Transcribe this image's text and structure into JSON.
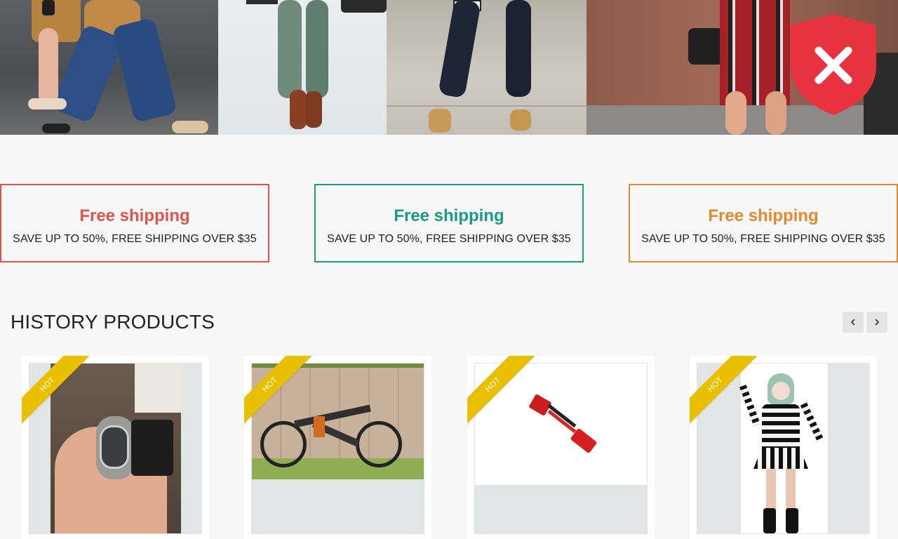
{
  "hero": {
    "panels": [
      "street-style-jeans-photo",
      "street-style-boots-photo",
      "street-style-leopard-flats-photo",
      "street-style-plaid-skirt-photo"
    ],
    "badge_icon": "shield-close-icon"
  },
  "shipping": [
    {
      "title": "Free shipping",
      "subtitle": "SAVE UP TO 50%, FREE SHIPPING OVER $35",
      "color": "#e0534a"
    },
    {
      "title": "Free shipping",
      "subtitle": "SAVE UP TO 50%, FREE SHIPPING OVER $35",
      "color": "#1a9b86"
    },
    {
      "title": "Free shipping",
      "subtitle": "SAVE UP TO 50%, FREE SHIPPING OVER $35",
      "color": "#e38a2c"
    }
  ],
  "section": {
    "title": "HISTORY PRODUCTS",
    "prev_icon": "chevron-left-icon",
    "next_icon": "chevron-right-icon"
  },
  "products": [
    {
      "badge": "HOT",
      "image": "watch-photo"
    },
    {
      "badge": "HOT",
      "image": "mountain-bike-photo"
    },
    {
      "badge": "HOT",
      "image": "battery-connector-photo"
    },
    {
      "badge": "HOT",
      "image": "striped-dress-costume-photo"
    }
  ],
  "colors": {
    "background": "#f7f7f7",
    "hot_ribbon": "#e9c000",
    "shield_red": "#e8323f"
  }
}
